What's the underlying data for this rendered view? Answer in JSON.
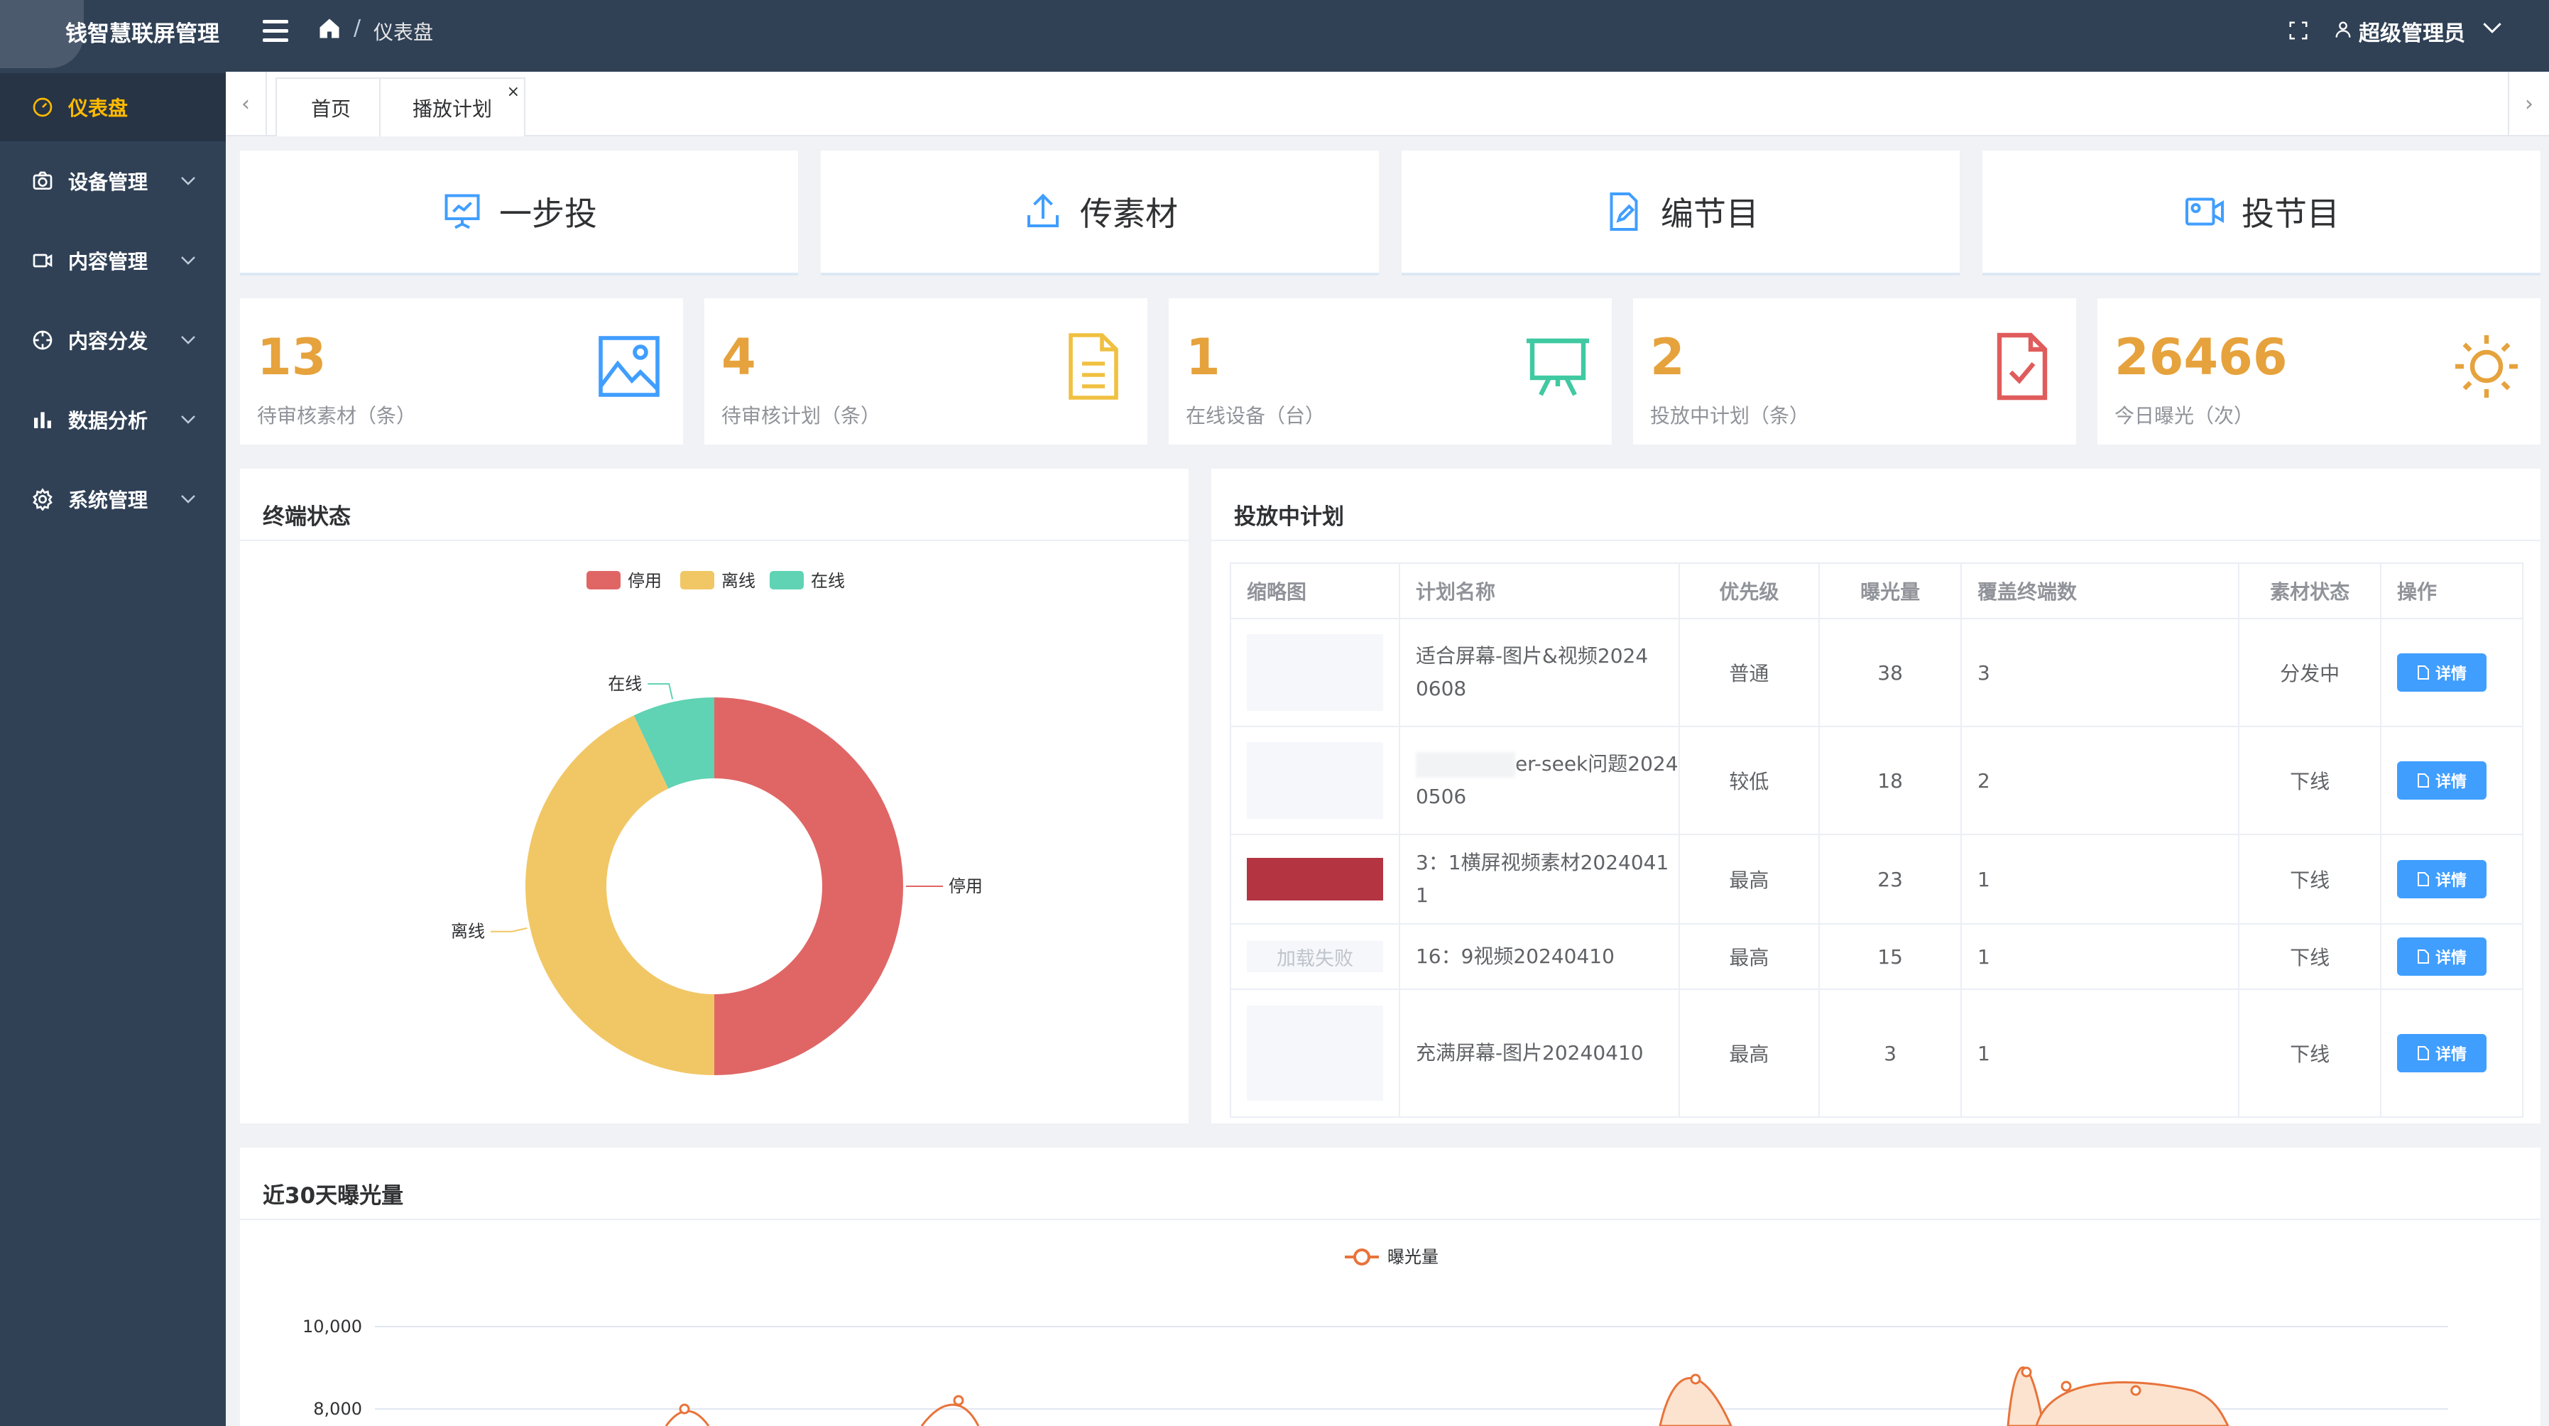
{
  "header": {
    "app_title": "钱智慧联屏管理",
    "breadcrumb_current": "仪表盘",
    "breadcrumb_sep": "/",
    "user_name": "超级管理员"
  },
  "sidebar": {
    "items": [
      {
        "label": "仪表盘",
        "icon": "dashboard-icon",
        "active": true
      },
      {
        "label": "设备管理",
        "icon": "camera-icon"
      },
      {
        "label": "内容管理",
        "icon": "video-icon"
      },
      {
        "label": "内容分发",
        "icon": "compass-icon"
      },
      {
        "label": "数据分析",
        "icon": "bar-chart-icon"
      },
      {
        "label": "系统管理",
        "icon": "gear-icon"
      }
    ]
  },
  "tabs": [
    {
      "label": "首页"
    },
    {
      "label": "播放计划",
      "closable": true
    }
  ],
  "tab_close": "×",
  "actions": [
    {
      "label": "一步投",
      "icon": "presentation-icon"
    },
    {
      "label": "传素材",
      "icon": "upload-icon"
    },
    {
      "label": "编节目",
      "icon": "edit-document-icon"
    },
    {
      "label": "投节目",
      "icon": "video-camera-icon"
    }
  ],
  "stats": [
    {
      "value": "13",
      "label": "待审核素材（条）",
      "icon": "image-icon",
      "color": "#409eff"
    },
    {
      "value": "4",
      "label": "待审核计划（条）",
      "icon": "document-icon",
      "color": "#f0c040"
    },
    {
      "value": "1",
      "label": "在线设备（台）",
      "icon": "display-board-icon",
      "color": "#40c9a2"
    },
    {
      "value": "2",
      "label": "投放中计划（条）",
      "icon": "checked-doc-icon",
      "color": "#e05c5c"
    },
    {
      "value": "26466",
      "label": "今日曝光（次）",
      "icon": "sun-icon",
      "color": "#e6a23c"
    }
  ],
  "terminal_panel": {
    "title": "终端状态"
  },
  "chart_data": [
    {
      "type": "pie",
      "legend": [
        "停用",
        "离线",
        "在线"
      ],
      "labels": [
        "停用",
        "离线",
        "在线"
      ],
      "values": [
        50,
        43,
        7
      ],
      "colors": [
        "#e06666",
        "#f1c765",
        "#5fd3b3"
      ]
    },
    {
      "type": "line",
      "legend": [
        "曝光量"
      ],
      "ytick_labels": [
        "10,000",
        "8,000"
      ],
      "color": "#e8733a"
    }
  ],
  "plans_panel": {
    "title": "投放中计划",
    "columns": [
      "缩略图",
      "计划名称",
      "优先级",
      "曝光量",
      "覆盖终端数",
      "素材状态",
      "操作"
    ],
    "rows": [
      {
        "name_line1": "适合屏幕-图片&视频2024",
        "name_line2": "0608",
        "priority": "普通",
        "exposure": "38",
        "terminals": "3",
        "status": "分发中",
        "thumb": "blank"
      },
      {
        "name_line1": "er-seek问题2024",
        "name_line2": "0506",
        "priority": "较低",
        "exposure": "18",
        "terminals": "2",
        "status": "下线",
        "thumb": "blank",
        "blurred": true
      },
      {
        "name_line1": "3：1横屏视频素材2024041",
        "name_line2": "1",
        "priority": "最高",
        "exposure": "23",
        "terminals": "1",
        "status": "下线",
        "thumb": "red"
      },
      {
        "name_line1": "16：9视频20240410",
        "name_line2": "",
        "priority": "最高",
        "exposure": "15",
        "terminals": "1",
        "status": "下线",
        "thumb": "fail",
        "thumb_text": "加载失败"
      },
      {
        "name_line1": "充满屏幕-图片20240410",
        "name_line2": "",
        "priority": "最高",
        "exposure": "3",
        "terminals": "1",
        "status": "下线",
        "thumb": "blank"
      }
    ],
    "detail_label": "详情"
  },
  "exposure_panel": {
    "title": "近30天曝光量"
  }
}
